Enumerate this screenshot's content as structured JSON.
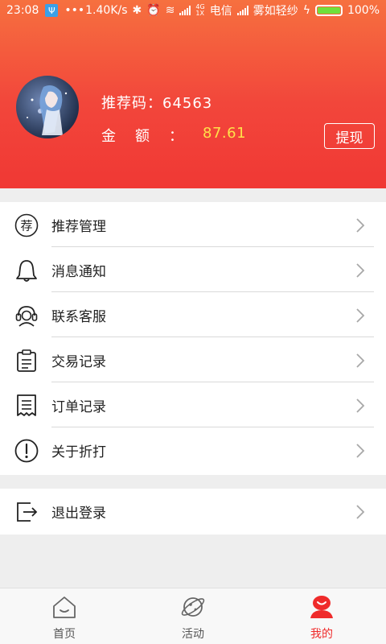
{
  "status_bar": {
    "time": "23:08",
    "usb": "Ψ",
    "dots": "•••",
    "speed": "1.40K/s",
    "network_small": "4G\n1X",
    "carrier1": "电信",
    "carrier2": "雾如轻纱",
    "battery_pct": "100%"
  },
  "profile": {
    "code_label": "推荐码：",
    "code_value": "64563",
    "amount_label": "金额：",
    "amount_value": "87.61",
    "withdraw_label": "提现"
  },
  "menu": {
    "items": [
      {
        "label": "推荐管理",
        "icon": "recommend-icon"
      },
      {
        "label": "消息通知",
        "icon": "bell-icon"
      },
      {
        "label": "联系客服",
        "icon": "headset-icon"
      },
      {
        "label": "交易记录",
        "icon": "clipboard-icon"
      },
      {
        "label": "订单记录",
        "icon": "receipt-icon"
      },
      {
        "label": "关于折打",
        "icon": "info-icon"
      }
    ],
    "logout": {
      "label": "退出登录",
      "icon": "logout-icon"
    }
  },
  "recommend_glyph": "荐",
  "tabs": [
    {
      "label": "首页",
      "icon": "home-icon",
      "active": false
    },
    {
      "label": "活动",
      "icon": "planet-icon",
      "active": false
    },
    {
      "label": "我的",
      "icon": "profile-icon",
      "active": true
    }
  ],
  "colors": {
    "accent": "#ef2b2b",
    "amount": "#ffe14a",
    "header_top": "#f6703f",
    "header_bottom": "#f03834"
  }
}
